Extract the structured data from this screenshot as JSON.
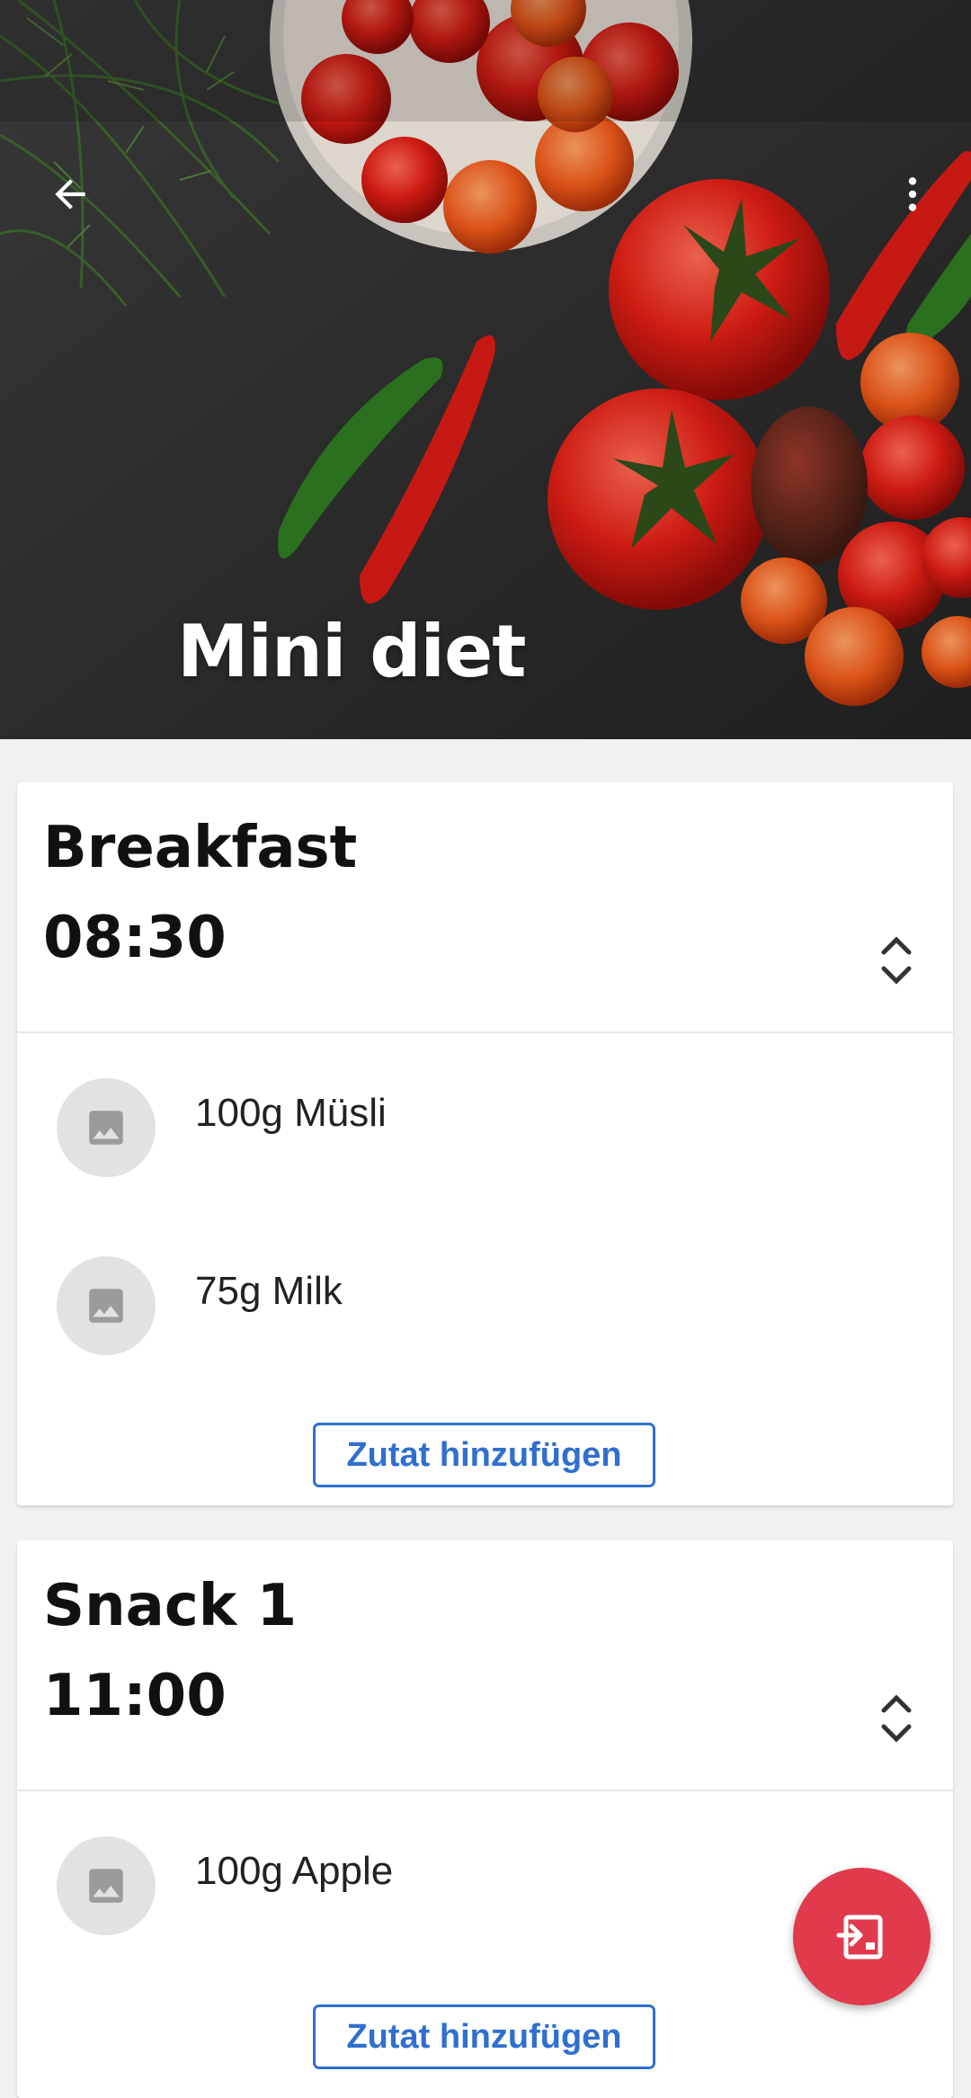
{
  "header": {
    "title": "Mini diet",
    "back_icon": "arrow-back-icon",
    "menu_icon": "more-vert-icon"
  },
  "meals": [
    {
      "name": "Breakfast",
      "time": "08:30",
      "ingredients": [
        {
          "label": "100g Müsli",
          "icon": "image-placeholder-icon"
        },
        {
          "label": "75g Milk",
          "icon": "image-placeholder-icon"
        }
      ],
      "add_label": "Zutat hinzufügen"
    },
    {
      "name": "Snack 1",
      "time": "11:00",
      "ingredients": [
        {
          "label": "100g Apple",
          "icon": "image-placeholder-icon"
        }
      ],
      "add_label": "Zutat hinzufügen"
    }
  ],
  "fab": {
    "icon": "pdf-export-icon"
  },
  "colors": {
    "accent": "#2f6fcf",
    "fab": "#e03a4c"
  }
}
